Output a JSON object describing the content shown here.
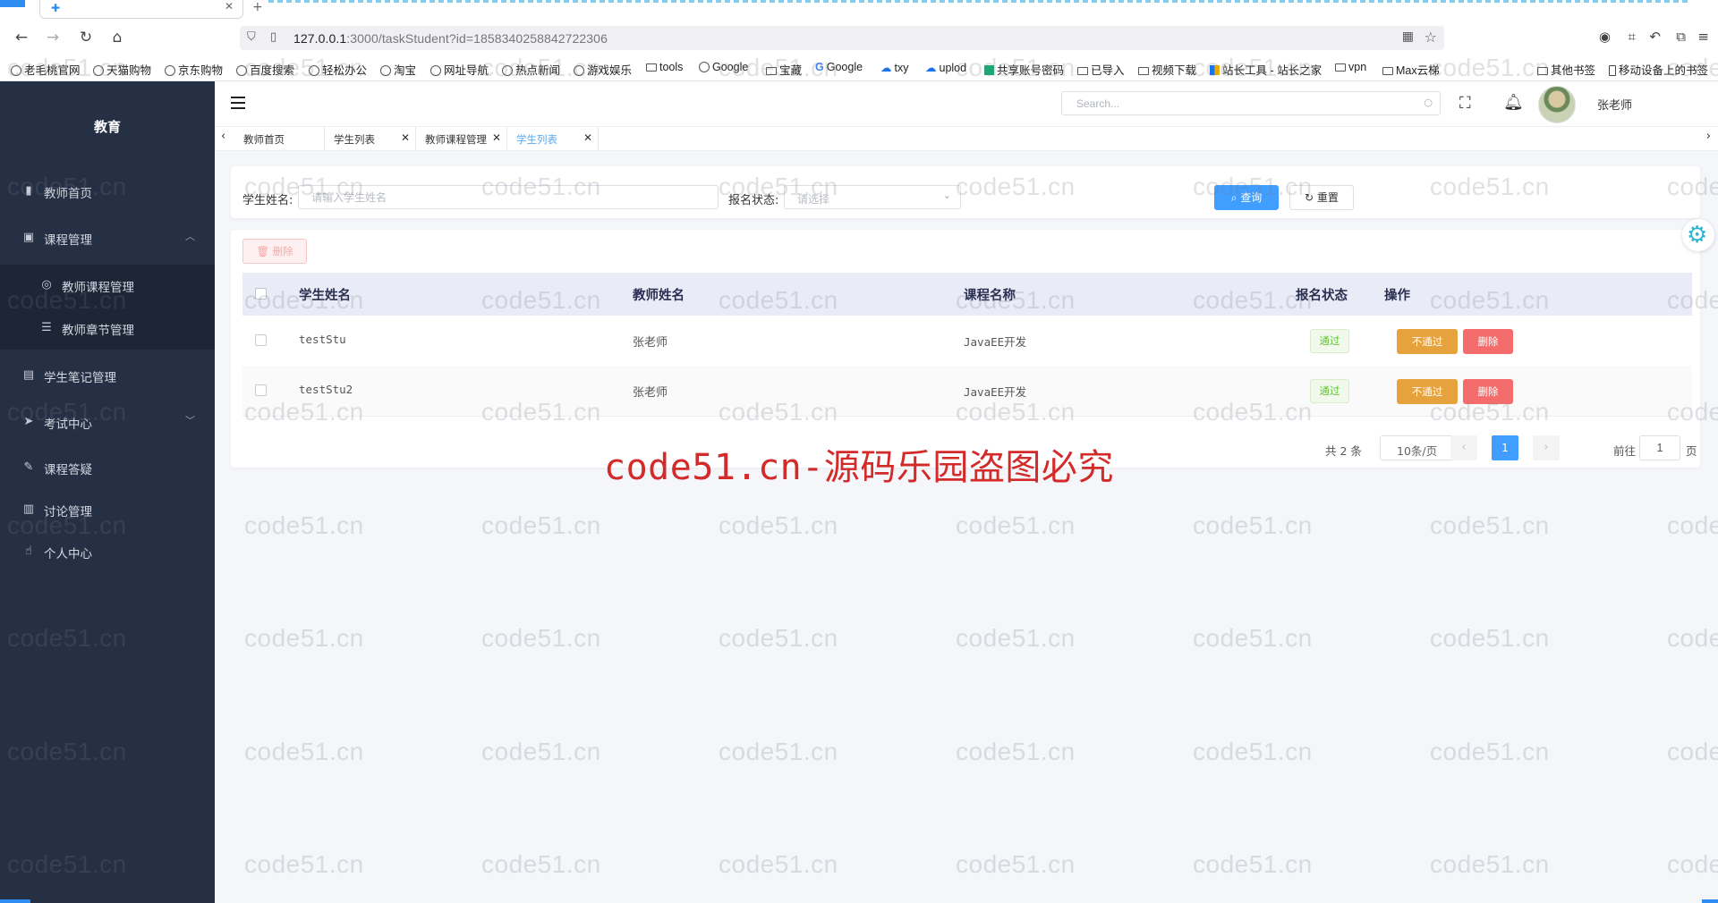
{
  "browser": {
    "url_host": "127.0.0.1",
    "url_rest": ":3000/taskStudent?id=1858340258842722306",
    "bookmarks": [
      "老毛桃官网",
      "天猫购物",
      "京东购物",
      "百度搜索",
      "轻松办公",
      "淘宝",
      "网址导航",
      "热点新闻",
      "游戏娱乐",
      "tools",
      "Google",
      "宝藏",
      "Google",
      "txy",
      "uplod",
      "共享账号密码",
      "已导入",
      "视频下载",
      "站长工具 - 站长之家",
      "vpn",
      "Max云梯",
      "其他书签",
      "移动设备上的书签"
    ]
  },
  "sidebar": {
    "brand": "教育",
    "items": [
      {
        "label": "教师首页",
        "icon": "chart-bar-icon"
      },
      {
        "label": "课程管理",
        "icon": "clipboard-icon"
      },
      {
        "label": "学生笔记管理",
        "icon": "document-icon"
      },
      {
        "label": "考试中心",
        "icon": "send-icon"
      },
      {
        "label": "课程答疑",
        "icon": "edit-icon"
      },
      {
        "label": "讨论管理",
        "icon": "book-icon"
      },
      {
        "label": "个人中心",
        "icon": "thumb-up-icon"
      }
    ],
    "submenu": [
      {
        "label": "教师课程管理",
        "icon": "circle-icon"
      },
      {
        "label": "教师章节管理",
        "icon": "sliders-icon"
      }
    ]
  },
  "topbar": {
    "search_placeholder": "Search...",
    "username": "张老师"
  },
  "tags": [
    {
      "label": "教师首页"
    },
    {
      "label": "学生列表"
    },
    {
      "label": "教师课程管理"
    },
    {
      "label": "学生列表"
    }
  ],
  "filters": {
    "name_label": "学生姓名:",
    "name_placeholder": "请输入学生姓名",
    "status_label": "报名状态:",
    "status_placeholder": "请选择",
    "query_label": "查询",
    "reset_label": "重置"
  },
  "table": {
    "delete_label": "删除",
    "columns": [
      "学生姓名",
      "教师姓名",
      "课程名称",
      "报名状态",
      "操作"
    ],
    "rows": [
      {
        "student": "testStu",
        "teacher": "张老师",
        "course": "JavaEE开发",
        "status": "通过",
        "reject": "不通过",
        "delete": "删除"
      },
      {
        "student": "testStu2",
        "teacher": "张老师",
        "course": "JavaEE开发",
        "status": "通过",
        "reject": "不通过",
        "delete": "删除"
      }
    ]
  },
  "pagination": {
    "total": "共 2 条",
    "page_size": "10条/页",
    "current": "1",
    "goto_label": "前往",
    "goto_value": "1",
    "page_suffix": "页"
  },
  "watermark": {
    "text": "code51.cn",
    "banner": "code51.cn-源码乐园盗图必究"
  }
}
